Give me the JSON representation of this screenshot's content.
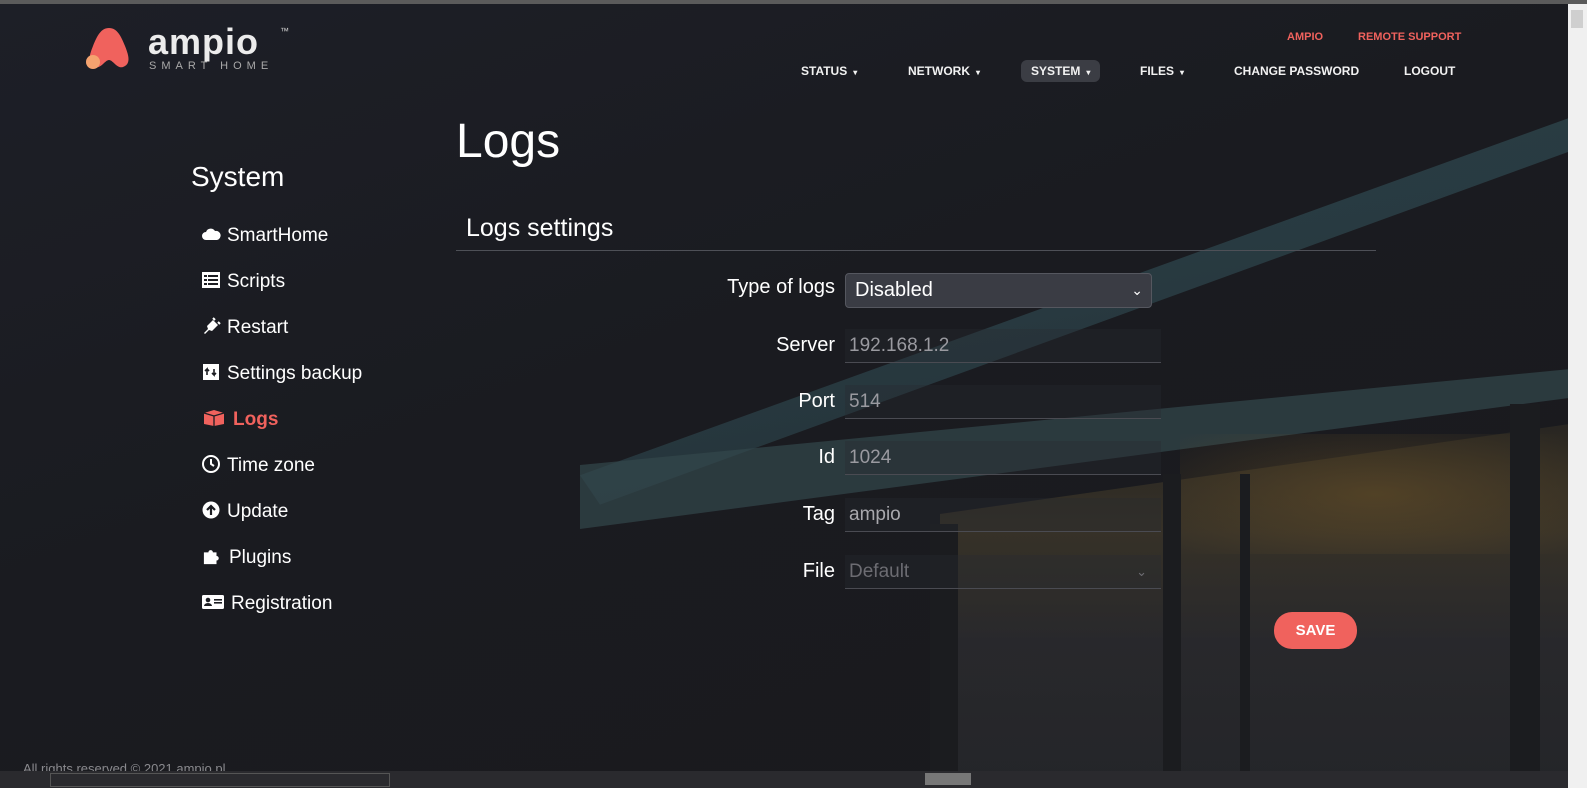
{
  "brand": {
    "name": "ampio",
    "tagline": "SMART HOME",
    "tm": "™",
    "logo_color": "#f0625d"
  },
  "top_links": {
    "ampio": "AMPIO",
    "remote_support": "REMOTE SUPPORT"
  },
  "nav": {
    "status": "STATUS",
    "network": "NETWORK",
    "system": "SYSTEM",
    "files": "FILES",
    "change_password": "CHANGE PASSWORD",
    "logout": "LOGOUT",
    "caret": "▾"
  },
  "page": {
    "title": "Logs"
  },
  "sidebar": {
    "title": "System",
    "items": [
      {
        "label": "SmartHome",
        "icon": "cloud-icon"
      },
      {
        "label": "Scripts",
        "icon": "list-icon"
      },
      {
        "label": "Restart",
        "icon": "plug-icon"
      },
      {
        "label": "Settings backup",
        "icon": "backup-icon"
      },
      {
        "label": "Logs",
        "icon": "box-icon",
        "active": true
      },
      {
        "label": "Time zone",
        "icon": "clock-icon"
      },
      {
        "label": "Update",
        "icon": "arrow-up-circle-icon"
      },
      {
        "label": "Plugins",
        "icon": "puzzle-icon"
      },
      {
        "label": "Registration",
        "icon": "id-card-icon"
      }
    ]
  },
  "logs_settings": {
    "title": "Logs settings",
    "type_label": "Type of logs",
    "type_value": "Disabled",
    "server_label": "Server",
    "server_value": "192.168.1.2",
    "port_label": "Port",
    "port_value": "514",
    "id_label": "Id",
    "id_value": "1024",
    "tag_label": "Tag",
    "tag_value": "ampio",
    "file_label": "File",
    "file_value": "Default",
    "save_label": "SAVE"
  },
  "footer": {
    "text": "All rights reserved © 2021 ampio.pl"
  },
  "colors": {
    "accent": "#f0625d",
    "background": "#1c1c22"
  }
}
